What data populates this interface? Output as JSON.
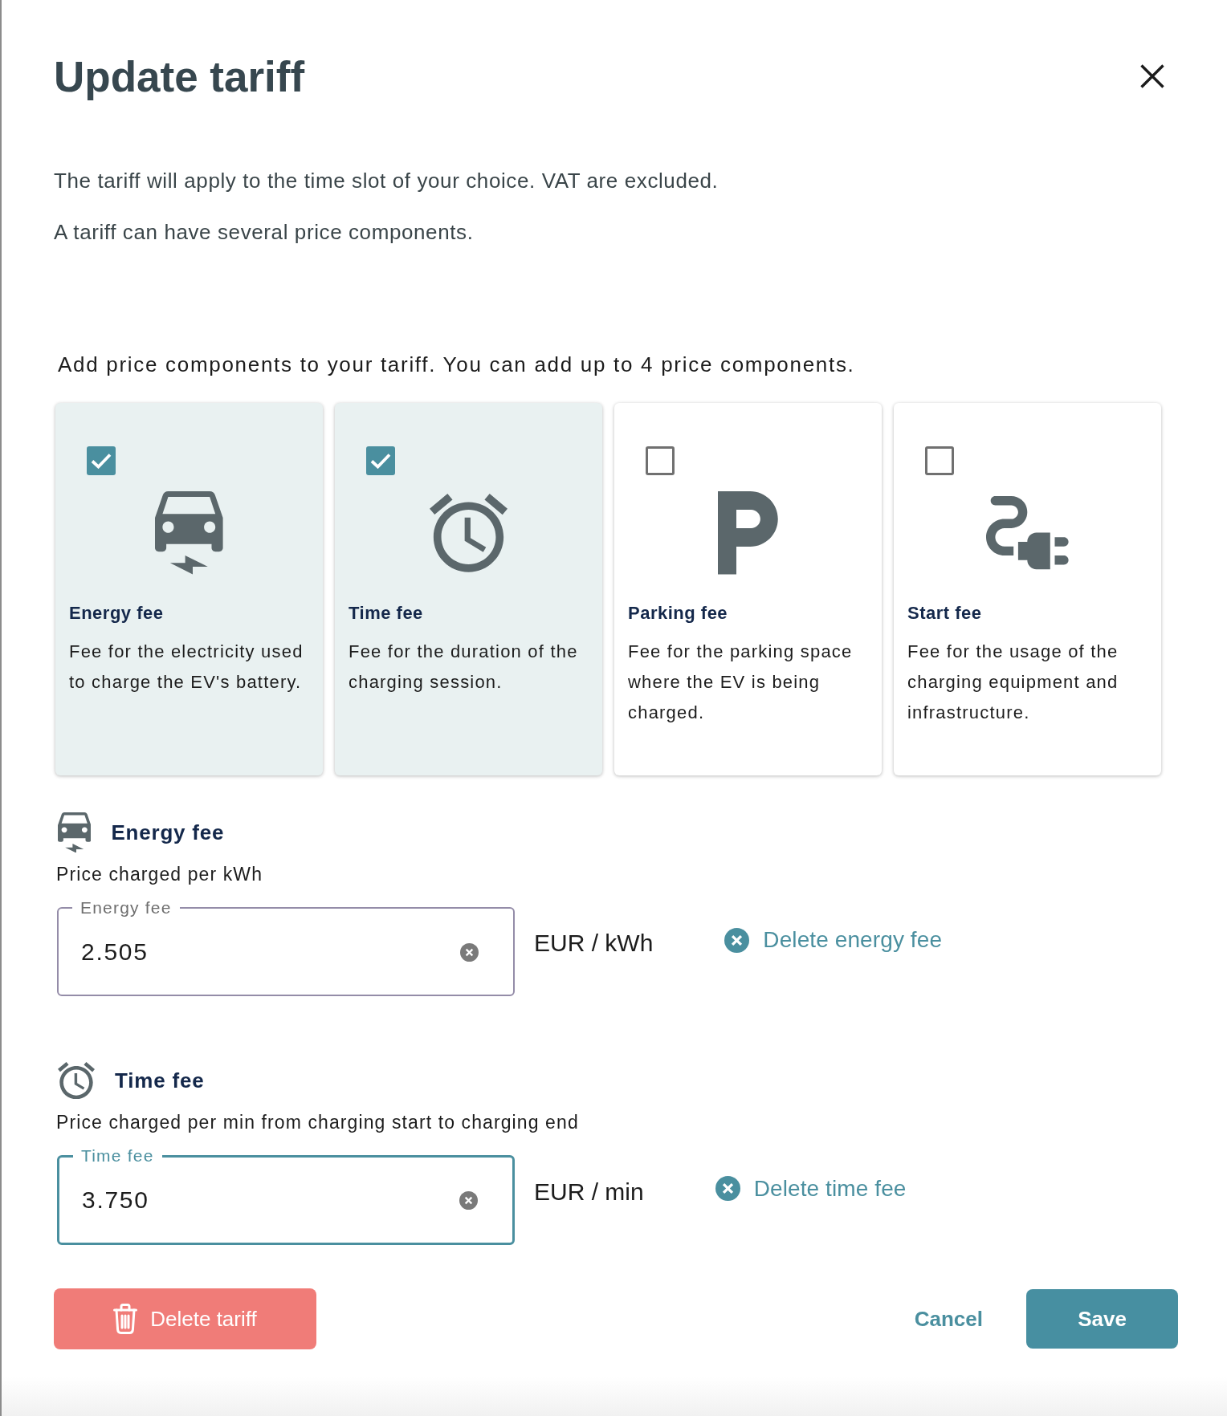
{
  "dialog": {
    "title": "Update tariff"
  },
  "intro": [
    "The tariff will apply to the time slot of your choice. VAT are excluded.",
    "A tariff can have several price components."
  ],
  "components_prompt": "Add price components to your tariff. You can add up to 4 price components.",
  "components": [
    {
      "kind": "energy",
      "title": "Energy fee",
      "description": "Fee for the electricity used to charge the EV's battery.",
      "checked": true
    },
    {
      "kind": "time",
      "title": "Time fee",
      "description": "Fee for the duration of the charging session.",
      "checked": true
    },
    {
      "kind": "parking",
      "title": "Parking fee",
      "description": "Fee for the parking space where the EV is being charged.",
      "checked": false
    },
    {
      "kind": "start",
      "title": "Start fee",
      "description": "Fee for the usage of the charging equipment and infrastructure.",
      "checked": false
    }
  ],
  "fees": [
    {
      "kind": "energy",
      "title": "Energy fee",
      "subtitle": "Price charged per kWh",
      "field": {
        "label": "Energy fee",
        "value": "2.505",
        "focused": false
      },
      "unit": "EUR / kWh",
      "delete_label": "Delete energy fee"
    },
    {
      "kind": "time",
      "title": "Time fee",
      "subtitle": "Price charged per min from charging start to charging end",
      "field": {
        "label": "Time fee",
        "value": "3.750",
        "focused": true
      },
      "unit": "EUR / min",
      "delete_label": "Delete time fee"
    }
  ],
  "actions": {
    "delete": "Delete tariff",
    "cancel": "Cancel",
    "save": "Save"
  }
}
